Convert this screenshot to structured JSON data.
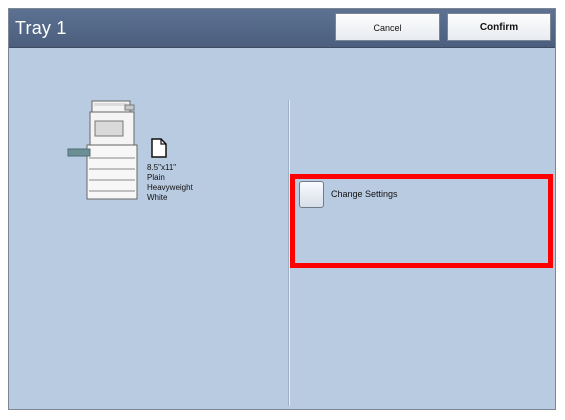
{
  "header": {
    "title": "Tray 1",
    "cancel_label": "Cancel",
    "confirm_label": "Confirm"
  },
  "tray": {
    "size": "8.5\"x11\"",
    "type": "Plain",
    "weight": "Heavyweight",
    "color": "White"
  },
  "settings": {
    "change_label": "Change Settings"
  },
  "colors": {
    "header": "#52668a",
    "panel": "#b9cbe0",
    "highlight": "#ff0000"
  },
  "icons": {
    "machine": "printer-copier-icon",
    "paper": "paper-sheet-icon"
  }
}
